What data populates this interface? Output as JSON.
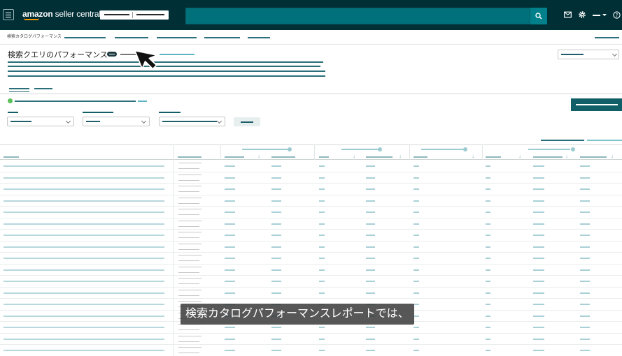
{
  "topbar": {
    "brand_bold": "amazon",
    "brand_light": " seller central",
    "menu_icon": "hamburger-menu-icon",
    "search_icon": "search-icon",
    "icons": [
      "mail-icon",
      "gear-icon",
      "help-icon"
    ]
  },
  "breadcrumb": "検索カタログパフォーマンス",
  "page_title": "検索クエリのパフォーマンス",
  "caption": "検索カタログパフォーマンスレポートでは、",
  "colors": {
    "topbar_bg": "#002f36",
    "search_bg": "#00707a",
    "accent": "#0f5e68",
    "link": "#5fb4c1",
    "status_green": "#5ac05a"
  },
  "table": {
    "row_count": 17,
    "metric_groups": 4
  }
}
